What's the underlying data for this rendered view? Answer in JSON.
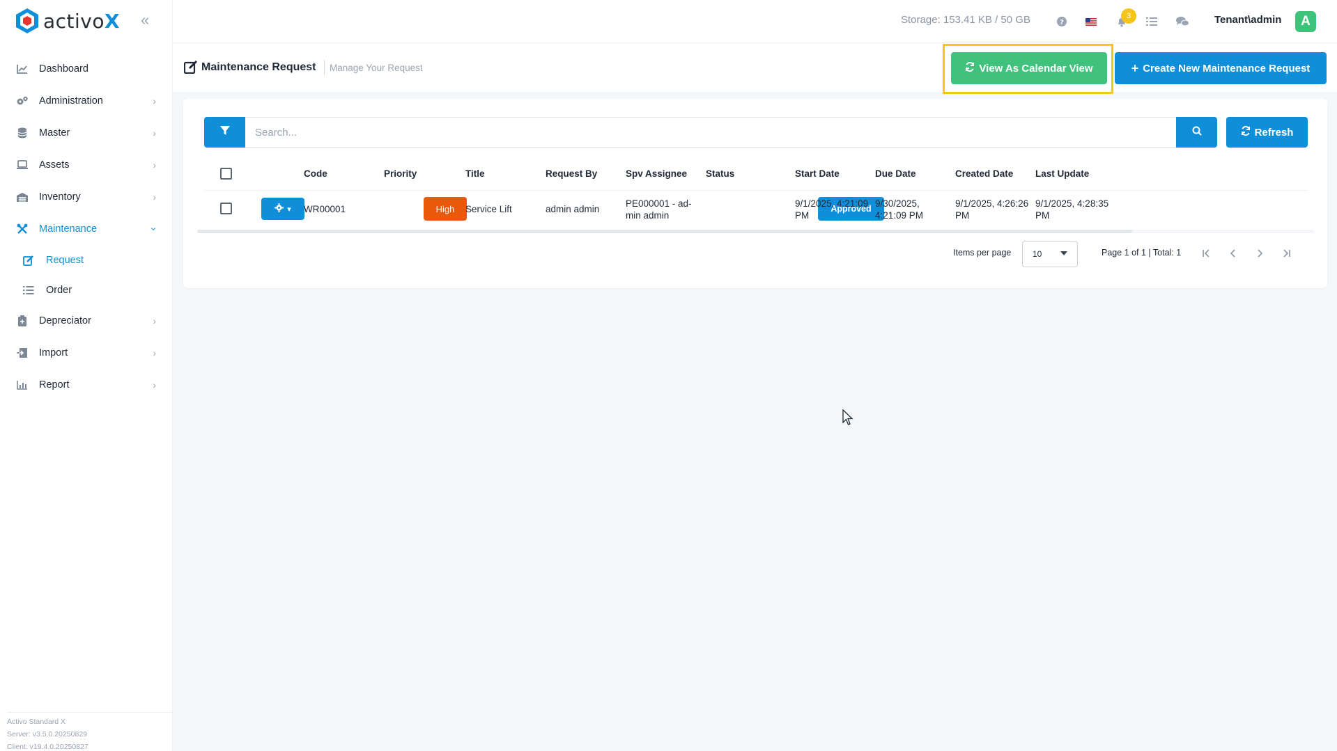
{
  "app": {
    "logo_text": "activo",
    "logo_accent": "X",
    "brand_color": "#0f8fd9"
  },
  "sidebar": {
    "items": [
      {
        "label": "Dashboard",
        "icon": "chart-line-icon"
      },
      {
        "label": "Administration",
        "icon": "gears-icon"
      },
      {
        "label": "Master",
        "icon": "database-icon"
      },
      {
        "label": "Assets",
        "icon": "laptop-icon"
      },
      {
        "label": "Inventory",
        "icon": "warehouse-icon"
      },
      {
        "label": "Maintenance",
        "icon": "tools-icon"
      },
      {
        "label": "Depreciator",
        "icon": "clipboard-icon"
      },
      {
        "label": "Import",
        "icon": "import-icon"
      },
      {
        "label": "Report",
        "icon": "bar-chart-icon"
      }
    ],
    "sub_items": [
      {
        "label": "Request",
        "icon": "edit-icon"
      },
      {
        "label": "Order",
        "icon": "list-icon"
      }
    ],
    "footer": {
      "product": "Activo Standard X",
      "server": "Server: v3.5.0.20250829",
      "client": "Client: v19.4.0.20250827"
    }
  },
  "topbar": {
    "storage": "Storage: 153.41 KB / 50 GB",
    "notification_count": "3",
    "user": "Tenant\\admin",
    "avatar_letter": "A"
  },
  "page": {
    "title": "Maintenance Request",
    "subtitle": "Manage Your Request",
    "calendar_button": "View As Calendar View",
    "create_button": "Create New Maintenance Request"
  },
  "toolbar": {
    "search_placeholder": "Search...",
    "refresh_label": "Refresh"
  },
  "table": {
    "columns": [
      "Code",
      "Priority",
      "Title",
      "Request By",
      "Spv Assignee",
      "Status",
      "Start Date",
      "Due Date",
      "Created Date",
      "Last Update"
    ],
    "rows": [
      {
        "code": "WR00001",
        "priority": "High",
        "title": "Service Lift",
        "request_by": "admin admin",
        "spv_assignee_1": "PE000001 - ad-",
        "spv_assignee_2": "min admin",
        "status": "Approved",
        "start_date_1": "9/1/2025, 4:21:09",
        "start_date_2": "PM",
        "due_date_1": "9/30/2025,",
        "due_date_2": "4:21:09 PM",
        "created_date_1": "9/1/2025, 4:26:26",
        "created_date_2": "PM",
        "last_update_1": "9/1/2025, 4:28:35",
        "last_update_2": "PM"
      }
    ]
  },
  "pagination": {
    "items_per_page_label": "Items per page",
    "items_per_page": "10",
    "page_info": "Page 1 of 1 | Total: 1"
  },
  "colors": {
    "primary": "#0f8fd9",
    "success": "#41c27c",
    "danger": "#e8590c",
    "highlight": "#f5c518"
  }
}
